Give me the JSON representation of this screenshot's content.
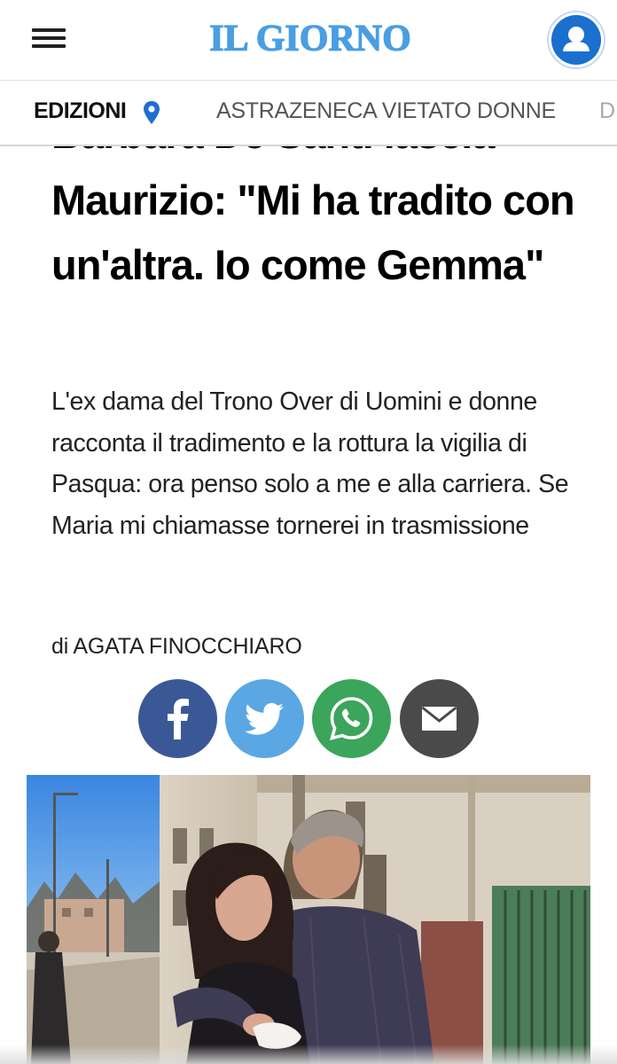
{
  "header": {
    "logo_text": "IL GIORNO",
    "brand_color": "#4a9ee2",
    "menu_icon": "hamburger-menu-icon",
    "account_icon": "user-account-icon"
  },
  "nav": {
    "editions_label": "EDIZIONI",
    "location_icon": "location-pin-icon",
    "links": [
      "ASTRAZENECA VIETATO DONNE",
      "D"
    ]
  },
  "article": {
    "headline_partial_line": "Barbara De Santi lascia",
    "headline": "Maurizio: \"Mi ha tradito con un'altra. Io come Gemma\"",
    "subtitle": "L'ex dama del Trono Over di Uomini e donne racconta il tradimento e la rottura la vigilia di Pasqua: ora penso solo a me e alla carriera. Se Maria mi chiamasse tornerei in trasmissione",
    "byline": "di AGATA FINOCCHIARO"
  },
  "share": {
    "facebook_icon": "facebook-icon",
    "twitter_icon": "twitter-icon",
    "whatsapp_icon": "whatsapp-icon",
    "email_icon": "email-icon",
    "colors": {
      "facebook": "#3b5896",
      "twitter": "#5aa7e4",
      "whatsapp": "#3aa55b",
      "email": "#4a4a4a"
    }
  }
}
